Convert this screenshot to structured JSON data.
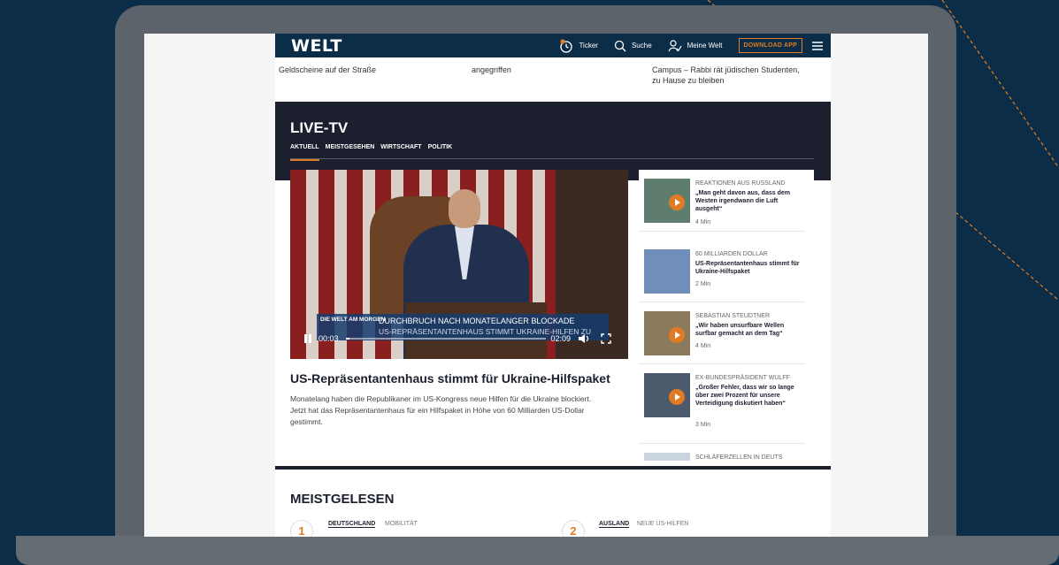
{
  "header": {
    "logo": "WELT",
    "ticker_label": "Ticker",
    "search_label": "Suche",
    "account_label": "Meine Welt",
    "download_label": "DOWNLOAD APP"
  },
  "top_links": {
    "item1": "Geldscheine auf der Straße",
    "item2": "angegriffen",
    "item3_line1": "Campus – Rabbi rät jüdischen Studenten,",
    "item3_line2": "zu Hause zu bleiben"
  },
  "live_tv": {
    "title": "LIVE-TV",
    "tabs": [
      "AKTUELL",
      "MEISTGESEHEN",
      "WIRTSCHAFT",
      "POLITIK"
    ],
    "video": {
      "brand": "DIE WELT AM MORGEN",
      "lower_third_1": "DURCHBRUCH NACH MONATELANGER BLOCKADE",
      "lower_third_2": "US-REPRÄSENTANTENHAUS STIMMT UKRAINE-HILFEN ZU",
      "time_current": "00:03",
      "time_total": "02:09",
      "progress": 0.02
    },
    "headline": "US-Repräsentantenhaus stimmt für Ukraine-Hilfspaket",
    "teaser": "Monatelang haben die Republikaner im US-Kongress neue Hilfen für die Ukraine blockiert. Jetzt hat das Repräsentantenhaus für ein Hilfspaket in Höhe von 60 Milliarden US-Dollar gestimmt.",
    "side_items": [
      {
        "kicker": "REAKTIONEN AUS RUSSLAND",
        "title": "„Man geht davon aus, dass dem Westen irgendwann die Luft ausgeht“",
        "duration": "4 Min"
      },
      {
        "kicker": "60 MILLIARDEN DOLLAR",
        "title": "US-Repräsentantenhaus stimmt für Ukraine-Hilfspaket",
        "duration": "2 Min"
      },
      {
        "kicker": "SEBASTIAN STEUDTNER",
        "title": "„Wir haben unsurfbare Wellen surfbar gemacht an dem Tag“",
        "duration": "4 Min"
      },
      {
        "kicker": "EX-BUNDESPRÄSIDENT WULFF",
        "title": "„Großer Fehler, dass wir so lange über zwei Prozent für unsere Verteidigung diskutiert haben“",
        "duration": "3 Min"
      },
      {
        "kicker": "SCHLÄFERZELLEN IN DEUTS",
        "title": "",
        "duration": ""
      }
    ]
  },
  "meistgelesen": {
    "title": "MEISTGELESEN",
    "items": [
      {
        "rank": "1",
        "section": "DEUTSCHLAND",
        "topic": "MOBILITÄT"
      },
      {
        "rank": "2",
        "section": "AUSLAND",
        "topic": "NEUE US-HILFEN"
      }
    ]
  },
  "colors": {
    "brand_navy": "#0c2d48",
    "accent_orange": "#e07b23",
    "live_dark": "#1c1f2e"
  }
}
